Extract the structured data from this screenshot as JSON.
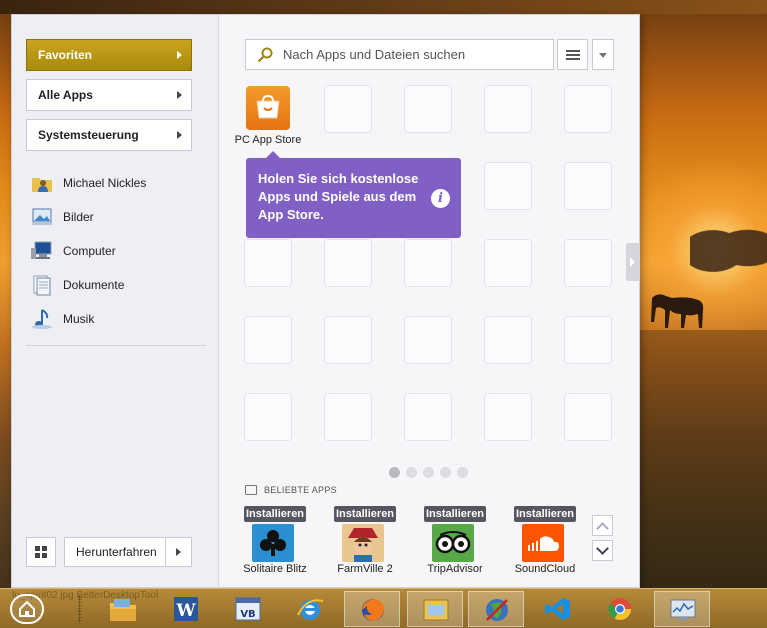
{
  "taskbar": {
    "ghost_text": "lu_spirit02.jpg   BetterDesktopTool",
    "items": [
      {
        "name": "explorer",
        "icon": "file-explorer-icon"
      },
      {
        "name": "word",
        "icon": "word-icon"
      },
      {
        "name": "vb",
        "icon": "visual-basic-icon"
      },
      {
        "name": "ie",
        "icon": "internet-explorer-icon"
      },
      {
        "name": "firefox",
        "icon": "firefox-icon"
      },
      {
        "name": "explorer-window",
        "icon": "window-explorer-icon"
      },
      {
        "name": "globe",
        "icon": "globe-icon"
      },
      {
        "name": "vs",
        "icon": "visual-studio-icon"
      },
      {
        "name": "chrome",
        "icon": "chrome-icon"
      },
      {
        "name": "monitor",
        "icon": "resource-monitor-icon"
      }
    ]
  },
  "left": {
    "buttons": [
      {
        "label": "Favoriten"
      },
      {
        "label": "Alle Apps"
      },
      {
        "label": "Systemsteuerung"
      }
    ],
    "places": [
      {
        "label": "Michael Nickles",
        "icon": "user-folder-icon"
      },
      {
        "label": "Bilder",
        "icon": "pictures-icon"
      },
      {
        "label": "Computer",
        "icon": "computer-icon"
      },
      {
        "label": "Dokumente",
        "icon": "documents-icon"
      },
      {
        "label": "Musik",
        "icon": "music-icon"
      }
    ],
    "shutdown_label": "Herunterfahren"
  },
  "search": {
    "placeholder": "Nach Apps und Dateien suchen"
  },
  "apps": {
    "store_label": "PC App Store",
    "tooltip": "Holen Sie sich kostenlose Apps und Spiele aus dem App Store.",
    "pages": 5,
    "current_page": 1
  },
  "popular": {
    "heading": "BELIEBTE APPS",
    "install_label": "Installieren",
    "items": [
      {
        "name": "Solitaire Blitz",
        "color": "#2a8fd0"
      },
      {
        "name": "FarmVille 2",
        "color": "#c8a070"
      },
      {
        "name": "TripAdvisor",
        "color": "#58a848"
      },
      {
        "name": "SoundCloud",
        "color": "#ff5500"
      }
    ]
  },
  "colors": {
    "favorites_active": "#b8960f",
    "tooltip": "#8060c4",
    "install_badge": "#565660"
  }
}
